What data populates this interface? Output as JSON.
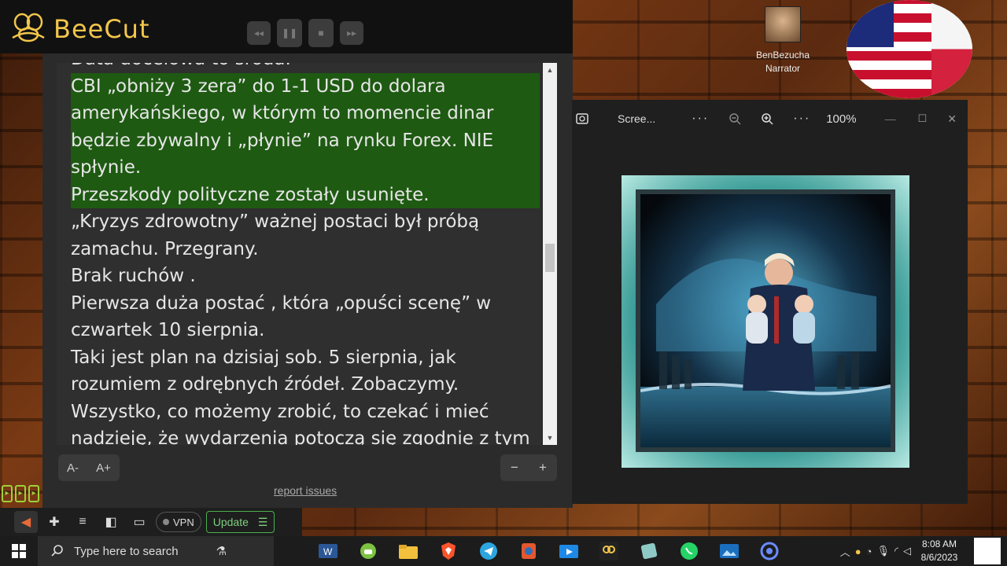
{
  "app": {
    "name": "BeeCut"
  },
  "reader": {
    "lines": [
      "Data docelowa to środa.",
      "CBI „obniży 3 zera” do 1-1 USD do dolara",
      "amerykańskiego, w którym to momencie dinar",
      "będzie zbywalny i „płynie” na rynku Forex. NIE",
      "spłynie.",
      "Przeszkody polityczne zostały usunięte.",
      "„Kryzys zdrowotny” ważnej postaci był próbą",
      "zamachu. Przegrany.",
      "Brak ruchów .",
      "Pierwsza duża postać , która „opuści scenę” w",
      "czwartek 10 sierpnia.",
      "Taki jest plan na dzisiaj sob. 5 sierpnia, jak",
      "rozumiem z odrębnych źródeł. Zobaczymy.",
      "Wszystko, co możemy zrobić, to czekać i mieć",
      "nadzieję, że wydarzenia potoczą się zgodnie z tym"
    ],
    "font_decrease": "A-",
    "font_increase": "A+",
    "zoom_minus": "−",
    "zoom_plus": "+",
    "report": "report issues"
  },
  "browser_bar": {
    "vpn": "VPN",
    "update": "Update"
  },
  "narrator": {
    "name": "BenBezucha",
    "role": "Narrator"
  },
  "photos": {
    "title": "Scree...",
    "zoom": "100%",
    "more": "···"
  },
  "taskbar": {
    "search_placeholder": "Type here to search",
    "time": "8:08 AM",
    "date": "8/6/2023"
  },
  "colors": {
    "accent": "#f2c64b",
    "highlight": "#1e5a12",
    "update_green": "#4caf50"
  }
}
